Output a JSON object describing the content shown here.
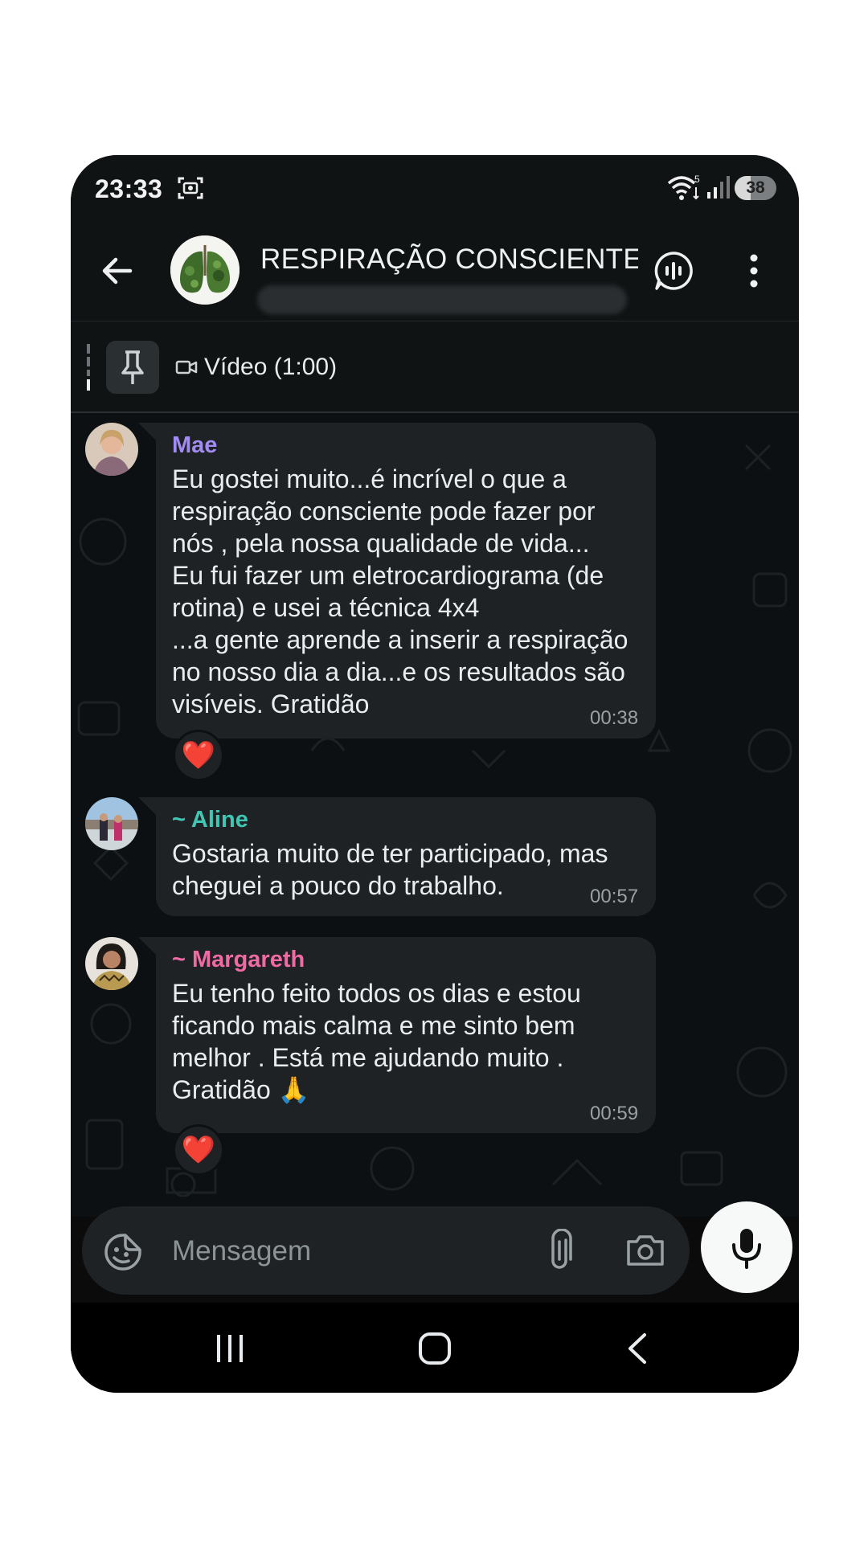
{
  "status_bar": {
    "time": "23:33",
    "wifi_badge": "5",
    "battery_level": "38"
  },
  "header": {
    "group_title": "RESPIRAÇÃO CONSCIENTE...",
    "avatar_icon": "lungs-tree-icon"
  },
  "pinned": {
    "text": "Vídeo (1:00)"
  },
  "messages": [
    {
      "sender": "Mae",
      "sender_color": "#a38bf5",
      "text": "Eu gostei muito...é  incrível o que a\nrespiração  consciente  pode fazer por\nnós , pela nossa qualidade de vida...\nEu fui fazer um eletrocardiograma (de\nrotina) e usei a técnica 4x4\n...a gente aprende a inserir a respiração\nno nosso dia a dia...e os resultados são\nvisíveis. Gratidão",
      "time": "00:38",
      "reaction": "❤️"
    },
    {
      "sender": "~ Aline",
      "sender_color": "#3fc7b4",
      "text": "Gostaria muito de ter participado, mas\ncheguei a pouco do trabalho.",
      "time": "00:57"
    },
    {
      "sender": "~ Margareth",
      "sender_color": "#f06ba3",
      "text": "Eu tenho feito todos os dias e estou\nficando mais calma e me sinto bem\nmelhor . Está me ajudando muito .\nGratidão 🙏",
      "time": "00:59",
      "reaction": "❤️"
    }
  ],
  "input": {
    "placeholder": "Mensagem"
  },
  "colors": {
    "background": "#0c1012",
    "bubble": "#1f2224",
    "header": "#101314"
  }
}
